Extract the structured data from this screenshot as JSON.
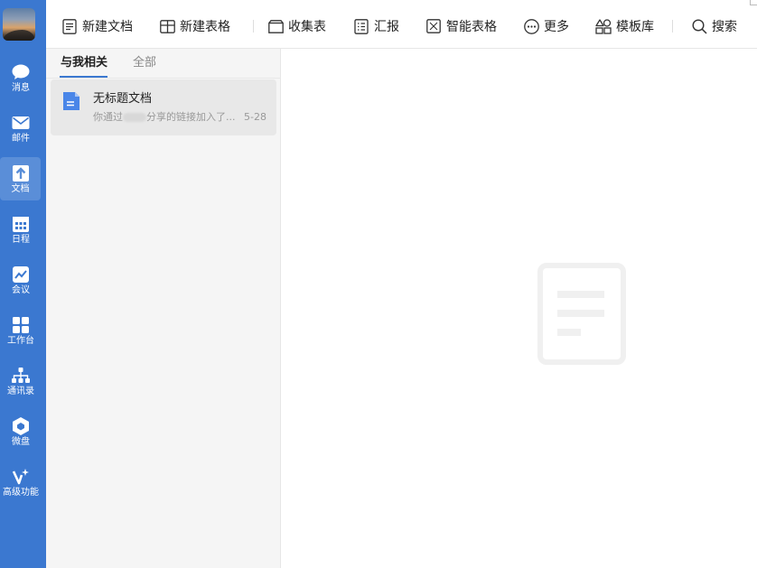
{
  "sidebar": {
    "items": [
      {
        "label": "消息",
        "icon": "chat-bubble-icon",
        "active": false
      },
      {
        "label": "邮件",
        "icon": "mail-icon",
        "active": false
      },
      {
        "label": "文档",
        "icon": "document-icon",
        "active": true
      },
      {
        "label": "日程",
        "icon": "calendar-icon",
        "active": false
      },
      {
        "label": "会议",
        "icon": "meeting-icon",
        "active": false
      },
      {
        "label": "工作台",
        "icon": "apps-grid-icon",
        "active": false
      },
      {
        "label": "通讯录",
        "icon": "org-chart-icon",
        "active": false
      },
      {
        "label": "微盘",
        "icon": "drive-icon",
        "active": false
      },
      {
        "label": "高级功能",
        "icon": "sparkle-icon",
        "active": false
      }
    ]
  },
  "toolbar": {
    "buttons": [
      {
        "label": "新建文档",
        "icon": "new-document-icon"
      },
      {
        "label": "新建表格",
        "icon": "new-sheet-icon"
      },
      {
        "label": "收集表",
        "icon": "form-icon"
      },
      {
        "label": "汇报",
        "icon": "report-icon"
      },
      {
        "label": "智能表格",
        "icon": "smart-sheet-icon"
      },
      {
        "label": "更多",
        "icon": "more-icon"
      },
      {
        "label": "模板库",
        "icon": "template-icon"
      },
      {
        "label": "搜索",
        "icon": "search-icon"
      }
    ]
  },
  "list": {
    "tabs": [
      {
        "label": "与我相关",
        "active": true
      },
      {
        "label": "全部",
        "active": false
      }
    ],
    "items": [
      {
        "title": "无标题文档",
        "subtitle_prefix": "你通过",
        "subtitle_suffix": "分享的链接加入了...",
        "date": "5-28",
        "icon": "doc-file-icon"
      }
    ]
  },
  "preview": {
    "empty_icon": "empty-document-icon"
  },
  "colors": {
    "rail": "#3b78d0",
    "rail_active": "#5a8ed8",
    "accent": "#3b78d0",
    "doc_icon": "#4a86e8"
  }
}
